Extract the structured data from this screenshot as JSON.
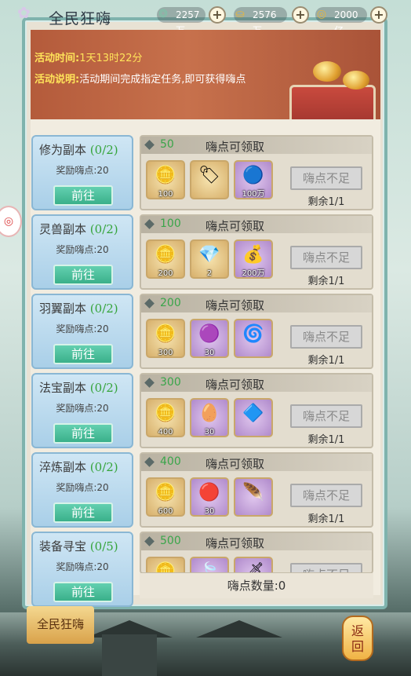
{
  "header": {
    "title": "全民狂嗨",
    "resources": [
      {
        "icon": "jade-icon",
        "value": "2257万",
        "color": "#7fc1a8"
      },
      {
        "icon": "gold-ingot-icon",
        "value": "2576万",
        "color": "#e6b63d"
      },
      {
        "icon": "coin-icon",
        "value": "2000亿",
        "color": "#e6b63d"
      }
    ]
  },
  "banner": {
    "time_label": "活动时间:",
    "time_value": "1天13时22分",
    "desc_label": "活动说明:",
    "desc_value": "活动期间完成指定任务,即可获得嗨点"
  },
  "categories": [
    {
      "name": "修为副本",
      "progress": "(0/2)",
      "reward": "奖励嗨点:20",
      "button": "前往"
    },
    {
      "name": "灵兽副本",
      "progress": "(0/2)",
      "reward": "奖励嗨点:20",
      "button": "前往"
    },
    {
      "name": "羽翼副本",
      "progress": "(0/2)",
      "reward": "奖励嗨点:20",
      "button": "前往"
    },
    {
      "name": "法宝副本",
      "progress": "(0/2)",
      "reward": "奖励嗨点:20",
      "button": "前往"
    },
    {
      "name": "淬炼副本",
      "progress": "(0/2)",
      "reward": "奖励嗨点:20",
      "button": "前往"
    },
    {
      "name": "装备寻宝",
      "progress": "(0/5)",
      "reward": "奖励嗨点:20",
      "button": "前往"
    }
  ],
  "reward_rows": [
    {
      "points": "50",
      "title": "嗨点可领取",
      "items": [
        {
          "icon": "gold-ingot-icon",
          "count": "100"
        },
        {
          "icon": "token-icon",
          "count": ""
        },
        {
          "icon": "blue-orb-icon",
          "count": "100万"
        }
      ],
      "button": "嗨点不足",
      "remain": "剩余1/1"
    },
    {
      "points": "100",
      "title": "嗨点可领取",
      "items": [
        {
          "icon": "gold-ingot-icon",
          "count": "200"
        },
        {
          "icon": "spirit-stone-icon",
          "count": "2"
        },
        {
          "icon": "coin-pile-icon",
          "count": "200万"
        }
      ],
      "button": "嗨点不足",
      "remain": "剩余1/1"
    },
    {
      "points": "200",
      "title": "嗨点可领取",
      "items": [
        {
          "icon": "gold-ingot-icon",
          "count": "300"
        },
        {
          "icon": "purple-orb-icon",
          "count": "30"
        },
        {
          "icon": "purple-swirl-icon",
          "count": ""
        }
      ],
      "button": "嗨点不足",
      "remain": "剩余1/1"
    },
    {
      "points": "300",
      "title": "嗨点可领取",
      "items": [
        {
          "icon": "gold-ingot-icon",
          "count": "400"
        },
        {
          "icon": "pink-egg-icon",
          "count": "30"
        },
        {
          "icon": "blue-gem-icon",
          "count": ""
        }
      ],
      "button": "嗨点不足",
      "remain": "剩余1/1"
    },
    {
      "points": "400",
      "title": "嗨点可领取",
      "items": [
        {
          "icon": "gold-ingot-icon",
          "count": "600"
        },
        {
          "icon": "red-crystal-icon",
          "count": "30"
        },
        {
          "icon": "blue-feather-icon",
          "count": ""
        }
      ],
      "button": "嗨点不足",
      "remain": "剩余1/1"
    },
    {
      "points": "500",
      "title": "嗨点可领取",
      "items": [
        {
          "icon": "gold-ingot-icon",
          "count": ""
        },
        {
          "icon": "green-leaf-icon",
          "count": ""
        },
        {
          "icon": "purple-blade-icon",
          "count": ""
        }
      ],
      "button": "嗨点不足",
      "remain": ""
    }
  ],
  "footer": {
    "total_points": "嗨点数量:0",
    "side_tab": "全民狂嗨",
    "back_button": "返回"
  }
}
